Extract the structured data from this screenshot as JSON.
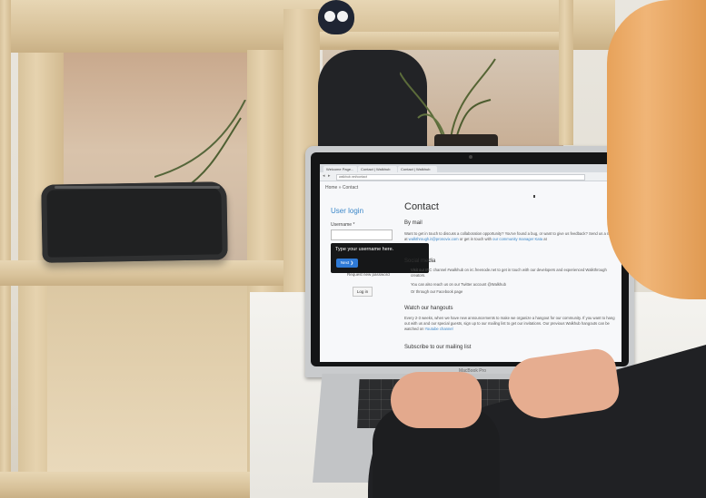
{
  "browser": {
    "tabs": [
      "Welcome Page...",
      "Contact | Walkhub",
      "Contact | Walkhub"
    ],
    "url": "walkhub.net/contact"
  },
  "page": {
    "breadcrumb": "Home  »  Contact",
    "sidebar": {
      "title": "User login",
      "username_label": "Username *",
      "password_link": "Request new password",
      "login_button": "Log in"
    },
    "tooltip": {
      "text": "Type your username here.",
      "next_button": "Next ❯"
    },
    "content": {
      "title": "Contact",
      "by_mail": "By mail",
      "mail_text_1": "Want to get in touch to discuss a collaboration opportunity? You've found a bug, or want to give us feedback?",
      "mail_text_2": "Send us a mail at",
      "mail_link": "walkthrough.it@pronovix.com",
      "mail_text_3": "or get in touch with",
      "mail_link_2": "our community manager Kata",
      "mail_text_4": "at",
      "social_title": "Social media",
      "social_1": "Visit our IRC channel #walkhub on irc.freenode.net to get in touch with our developers and experienced Walkthrough creators.",
      "social_2": "You can also reach us on our Twitter account",
      "social_2_link": "@Walkhub",
      "social_3": "Or through",
      "social_3_link": "our Facebook page",
      "hangouts_title": "Watch our hangouts",
      "hangouts_text": "Every 2-3 weeks, when we have new announcements to make we organize a hangout for our community. If you want to hang out with us and our special guests, sign up to our mailing list to get our invitations. Our previous Walkhub hangouts can be watched on",
      "hangouts_link": "Youtube channel",
      "mailing_title": "Subscribe to our mailing list"
    }
  },
  "laptop": {
    "brand": "MacBook Pro"
  },
  "colors": {
    "link": "#3a86c8",
    "tooltip": "#161718",
    "next_button": "#2f7ad6"
  }
}
